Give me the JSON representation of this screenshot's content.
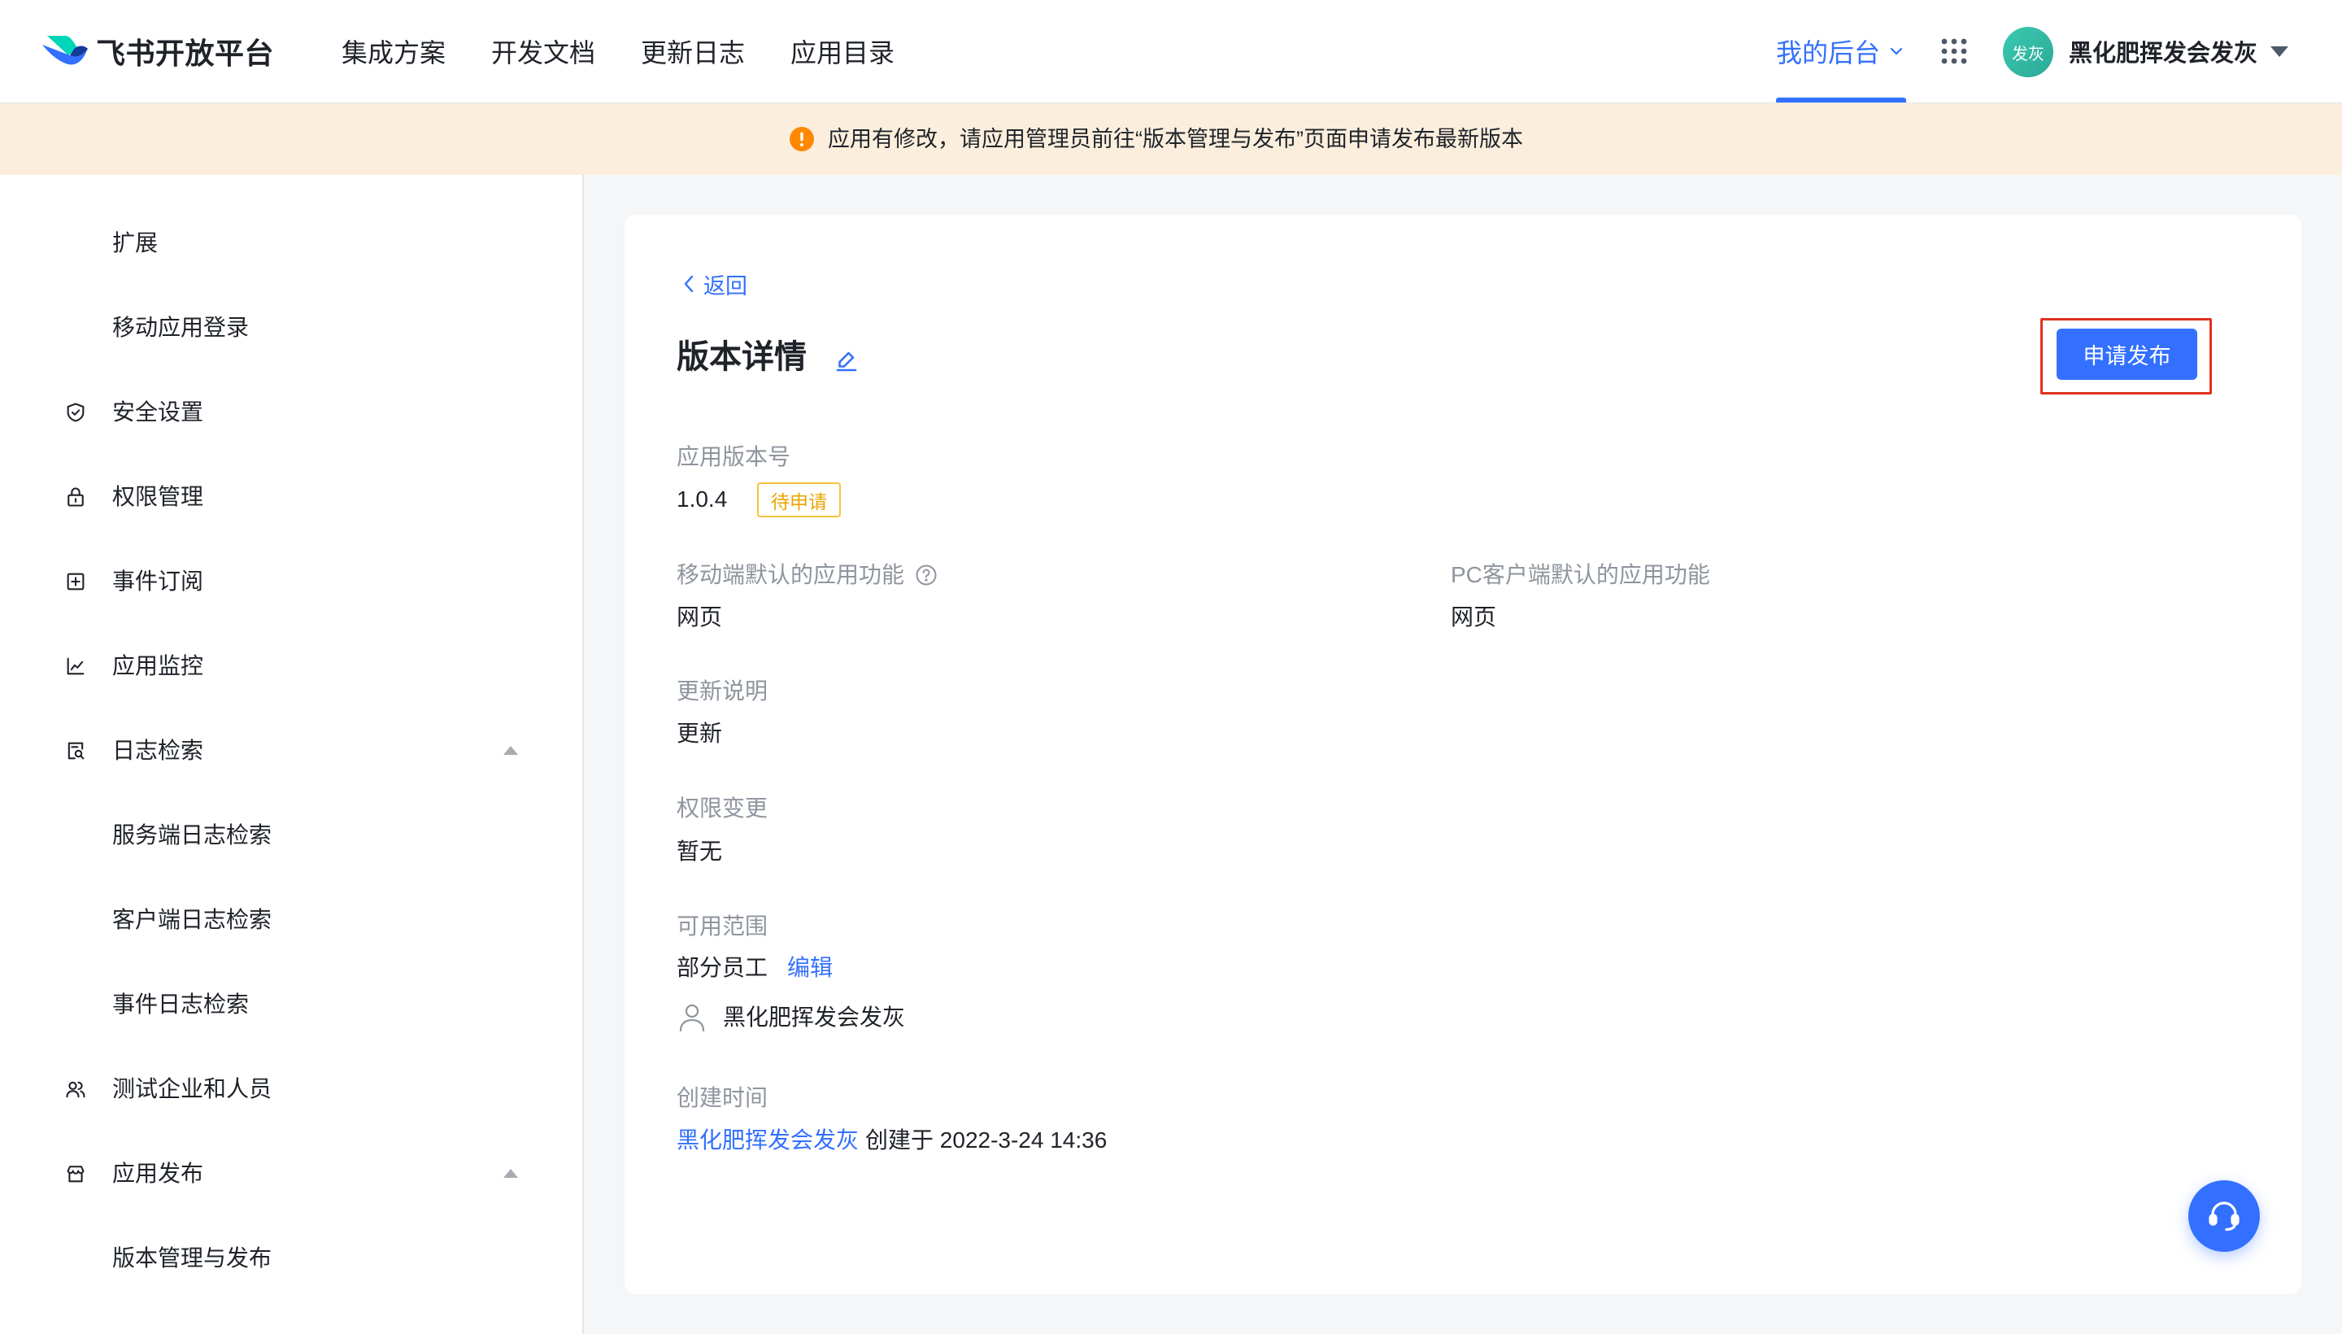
{
  "header": {
    "brand": "飞书开放平台",
    "logo_icon": "feishu-logo-icon",
    "nav": [
      "集成方案",
      "开发文档",
      "更新日志",
      "应用目录"
    ],
    "console_label": "我的后台",
    "avatar_text": "发灰",
    "user_name": "黑化肥挥发会发灰"
  },
  "banner": {
    "icon": "warning-icon",
    "message": "应用有修改，请应用管理员前往“版本管理与发布”页面申请发布最新版本"
  },
  "sidebar": {
    "items": [
      {
        "label": "扩展",
        "icon": null
      },
      {
        "label": "移动应用登录",
        "icon": null
      },
      {
        "label": "安全设置",
        "icon": "shield-icon"
      },
      {
        "label": "权限管理",
        "icon": "lock-icon"
      },
      {
        "label": "事件订阅",
        "icon": "plus-square-icon"
      },
      {
        "label": "应用监控",
        "icon": "line-chart-icon"
      },
      {
        "label": "日志检索",
        "icon": "log-search-icon",
        "expanded": true
      },
      {
        "label": "服务端日志检索",
        "icon": null
      },
      {
        "label": "客户端日志检索",
        "icon": null
      },
      {
        "label": "事件日志检索",
        "icon": null
      },
      {
        "label": "测试企业和人员",
        "icon": "users-icon"
      },
      {
        "label": "应用发布",
        "icon": "store-icon",
        "expanded": true
      },
      {
        "label": "版本管理与发布",
        "icon": null
      }
    ]
  },
  "content": {
    "back_label": "返回",
    "title": "版本详情",
    "publish_button": "申请发布",
    "version": {
      "label": "应用版本号",
      "value": "1.0.4",
      "status": "待申请"
    },
    "mobile_default": {
      "label": "移动端默认的应用功能",
      "value": "网页"
    },
    "pc_default": {
      "label": "PC客户端默认的应用功能",
      "value": "网页"
    },
    "release_notes": {
      "label": "更新说明",
      "value": "更新"
    },
    "permission_changes": {
      "label": "权限变更",
      "value": "暂无"
    },
    "scope": {
      "label": "可用范围",
      "value": "部分员工",
      "edit": "编辑",
      "member": "黑化肥挥发会发灰"
    },
    "created": {
      "label": "创建时间",
      "creator": "黑化肥挥发会发灰",
      "text": "创建于 2022-3-24 14:36"
    }
  },
  "colors": {
    "accent": "#3370ff",
    "banner_bg": "#fbeedd",
    "warning": "#ff8800",
    "status_pending": "#eba400",
    "highlight_box": "#e0321d",
    "avatar": "#34bfa7"
  }
}
